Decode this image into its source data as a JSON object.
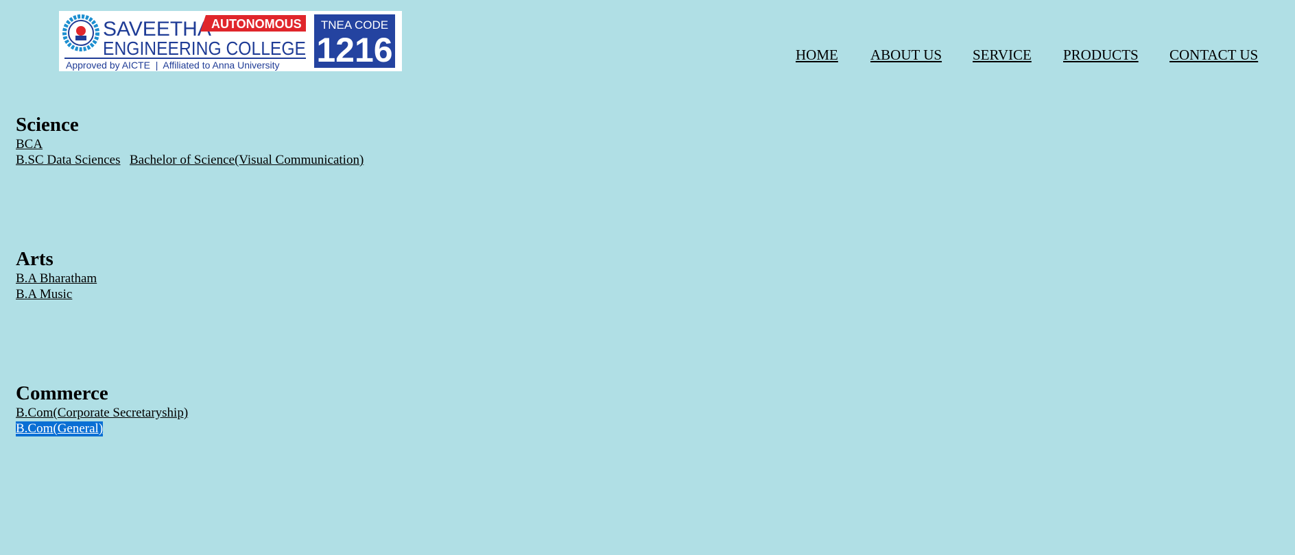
{
  "colors": {
    "page_background": "#b0dfe5",
    "logo_blue": "#1f3c96",
    "logo_red": "#e0262b",
    "selection_highlight": "#0a6fd4"
  },
  "logo": {
    "line1": "SAVEETHA",
    "badge": "AUTONOMOUS",
    "line2": "ENGINEERING COLLEGE",
    "approval": "Approved by AICTE  |  Affiliated to Anna University",
    "code_label": "TNEA CODE",
    "code_number": "1216",
    "emblem": "college-emblem-icon"
  },
  "nav": {
    "items": [
      {
        "label": "HOME"
      },
      {
        "label": "ABOUT US"
      },
      {
        "label": "SERVICE"
      },
      {
        "label": "PRODUCTS"
      },
      {
        "label": "CONTACT US"
      }
    ]
  },
  "sections": [
    {
      "heading": "Science",
      "links": [
        {
          "label": "BCA"
        },
        {
          "label": "B.SC Data Sciences"
        },
        {
          "label": "Bachelor of Science(Visual Communication)"
        }
      ]
    },
    {
      "heading": "Arts",
      "links": [
        {
          "label": "B.A Bharatham"
        },
        {
          "label": "B.A Music"
        }
      ]
    },
    {
      "heading": "Commerce",
      "links": [
        {
          "label": "B.Com(Corporate Secretaryship)"
        },
        {
          "label": "B.Com(General)",
          "selected": true
        }
      ]
    }
  ]
}
